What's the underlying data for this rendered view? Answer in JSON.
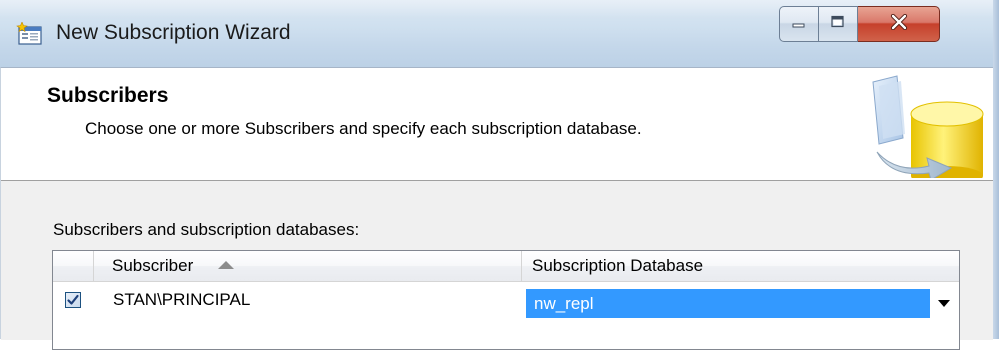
{
  "window": {
    "title": "New Subscription Wizard",
    "icon": "wizard-app-icon"
  },
  "caption": {
    "minimize_icon": "minimize-icon",
    "maximize_icon": "maximize-icon",
    "close_icon": "close-icon"
  },
  "header": {
    "title": "Subscribers",
    "description": "Choose one or more Subscribers and specify each subscription database.",
    "graphic": "database-replication-graphic"
  },
  "body": {
    "grid_label": "Subscribers and subscription databases:",
    "columns": {
      "subscriber": "Subscriber",
      "subscription_database": "Subscription Database",
      "sort_icon": "sort-ascending-icon"
    },
    "rows": [
      {
        "checked": true,
        "subscriber": "STAN\\PRINCIPAL",
        "subscription_database": "nw_repl"
      }
    ]
  },
  "colors": {
    "selection": "#3399ff",
    "close_button": "#c6402b"
  }
}
